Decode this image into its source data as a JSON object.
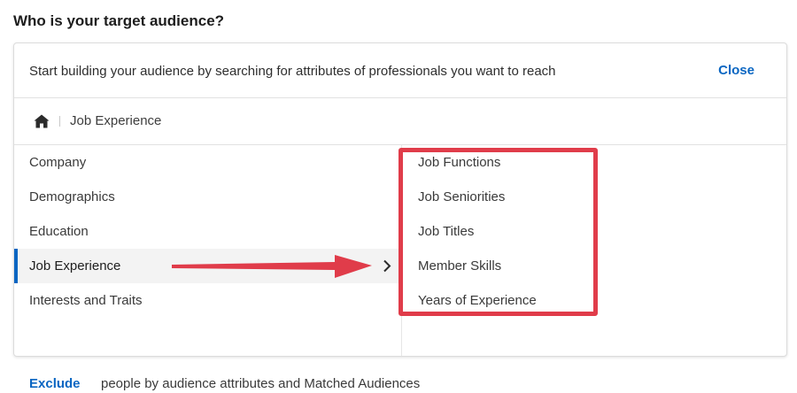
{
  "heading": "Who is your target audience?",
  "panel": {
    "intro": "Start building your audience by searching for attributes of professionals you want to reach",
    "close_label": "Close"
  },
  "breadcrumb": {
    "home_icon": "home-icon",
    "current": "Job Experience"
  },
  "categories": [
    {
      "label": "Company"
    },
    {
      "label": "Demographics"
    },
    {
      "label": "Education"
    },
    {
      "label": "Job Experience",
      "active": true
    },
    {
      "label": "Interests and Traits"
    }
  ],
  "subcategories": [
    {
      "label": "Job Functions"
    },
    {
      "label": "Job Seniorities"
    },
    {
      "label": "Job Titles"
    },
    {
      "label": "Member Skills"
    },
    {
      "label": "Years of Experience"
    }
  ],
  "footer": {
    "exclude_label": "Exclude",
    "text": "people by audience attributes and Matched Audiences"
  },
  "colors": {
    "accent": "#0a66c2",
    "annotation": "#e03c4a"
  }
}
